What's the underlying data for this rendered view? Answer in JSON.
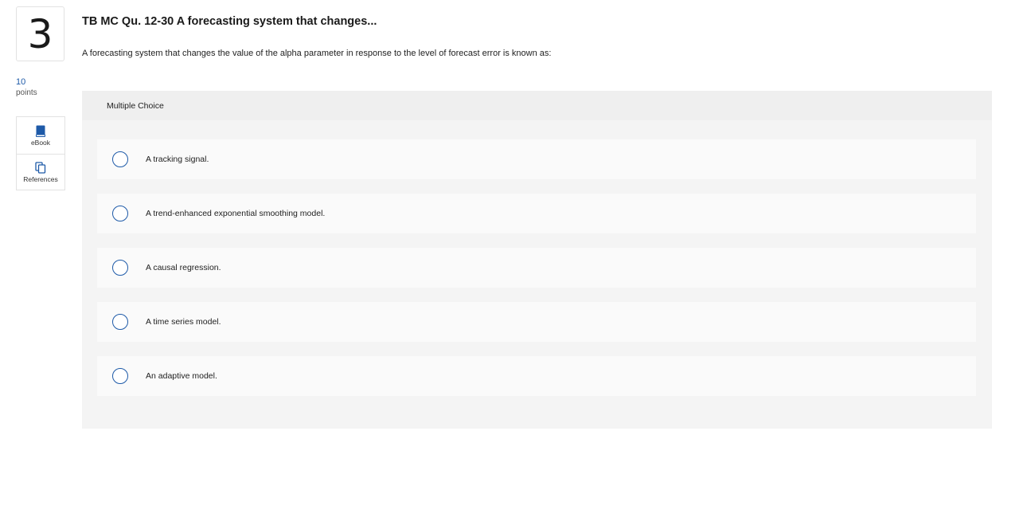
{
  "question": {
    "number": "3",
    "points_value": "10",
    "points_label": "points",
    "title": "TB MC Qu. 12-30 A forecasting system that changes...",
    "prompt": "A forecasting system that changes the value of the alpha parameter in response to the level of forecast error is known as:"
  },
  "tools": [
    {
      "label": "eBook",
      "icon": "book-icon"
    },
    {
      "label": "References",
      "icon": "copy-icon"
    }
  ],
  "answer_panel": {
    "type_label": "Multiple Choice",
    "options": [
      {
        "text": "A tracking signal.",
        "selected": false
      },
      {
        "text": "A trend-enhanced exponential smoothing model.",
        "selected": false
      },
      {
        "text": "A causal regression.",
        "selected": false
      },
      {
        "text": "A time series model.",
        "selected": false
      },
      {
        "text": "An adaptive model.",
        "selected": false
      }
    ]
  },
  "colors": {
    "accent": "#1e5aa8",
    "panel_bg": "#f4f4f4",
    "option_bg": "#fafafa"
  }
}
